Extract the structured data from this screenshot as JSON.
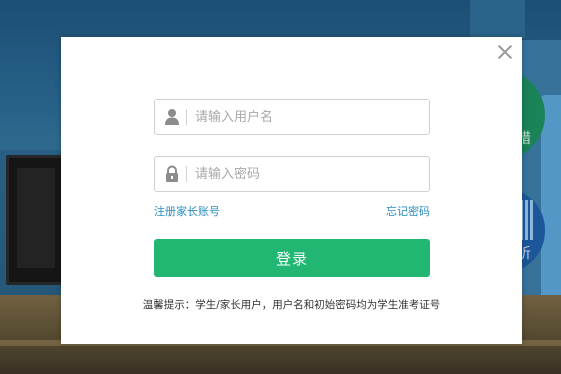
{
  "background": {
    "green_circle_text": "猎",
    "blue_circle_text": "听"
  },
  "login_modal": {
    "username_placeholder": "请输入用户名",
    "password_placeholder": "请输入密码",
    "register_link": "注册家长账号",
    "forgot_password_link": "忘记密码",
    "login_button": "登录",
    "hint": "温馨提示：学生/家长用户，用户名和初始密码均为学生准考证号"
  },
  "colors": {
    "primary_button": "#21b773",
    "link": "#2a8dbf",
    "overlay_background": "#1d4d73"
  },
  "icons": {
    "close": "close-icon",
    "user": "user-icon",
    "lock": "lock-icon"
  }
}
